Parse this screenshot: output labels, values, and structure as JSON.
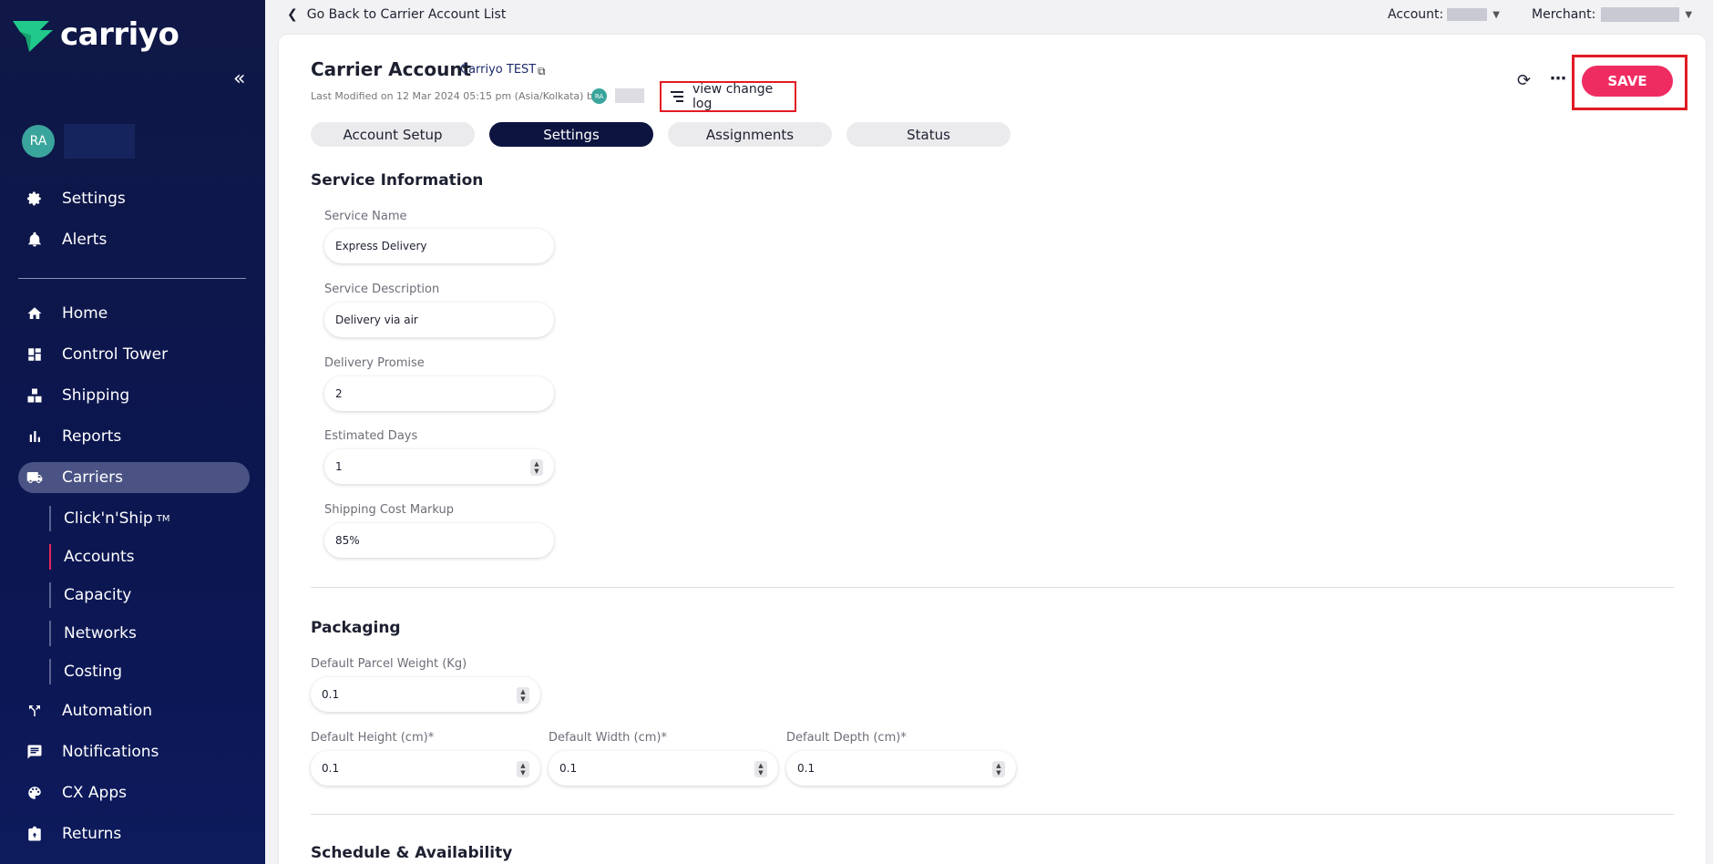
{
  "brand": {
    "name": "carriyo"
  },
  "sidebar": {
    "collapse_icon": "double-chevron-left-icon",
    "user_initials": "RA",
    "top_items": [
      {
        "label": "Settings",
        "icon": "gear-icon"
      },
      {
        "label": "Alerts",
        "icon": "bell-icon"
      }
    ],
    "items": [
      {
        "label": "Home",
        "icon": "home-icon"
      },
      {
        "label": "Control Tower",
        "icon": "dashboard-icon"
      },
      {
        "label": "Shipping",
        "icon": "boxes-icon"
      },
      {
        "label": "Reports",
        "icon": "bar-chart-icon"
      },
      {
        "label": "Carriers",
        "icon": "truck-icon"
      },
      {
        "label": "Automation",
        "icon": "fork-icon"
      },
      {
        "label": "Notifications",
        "icon": "message-icon"
      },
      {
        "label": "CX Apps",
        "icon": "palette-icon"
      },
      {
        "label": "Returns",
        "icon": "return-box-icon"
      }
    ],
    "carrier_sub_items": [
      {
        "label": "Click'n'Ship",
        "sup": "TM"
      },
      {
        "label": "Accounts"
      },
      {
        "label": "Capacity"
      },
      {
        "label": "Networks"
      },
      {
        "label": "Costing"
      }
    ]
  },
  "topbar": {
    "back_label": "Go Back to Carrier Account List",
    "account_label": "Account:",
    "merchant_label": "Merchant:"
  },
  "header": {
    "title": "Carrier Account",
    "account_name": "Carriyo TEST",
    "last_modified": "Last Modified on 12 Mar 2024 05:15 pm (Asia/Kolkata) by",
    "modifier_initials": "RA",
    "change_log_label": "view change log",
    "save_label": "SAVE"
  },
  "tabs": [
    {
      "label": "Account Setup",
      "active": false
    },
    {
      "label": "Settings",
      "active": true
    },
    {
      "label": "Assignments",
      "active": false
    },
    {
      "label": "Status",
      "active": false
    }
  ],
  "service_information": {
    "title": "Service Information",
    "service_name": {
      "label": "Service Name",
      "value": "Express Delivery"
    },
    "service_description": {
      "label": "Service Description",
      "value": "Delivery via air"
    },
    "delivery_promise": {
      "label": "Delivery Promise",
      "value": "2"
    },
    "estimated_days": {
      "label": "Estimated Days",
      "value": "1"
    },
    "shipping_cost_markup": {
      "label": "Shipping Cost Markup",
      "value": "85%"
    }
  },
  "packaging": {
    "title": "Packaging",
    "parcel_weight": {
      "label": "Default Parcel Weight (Kg)",
      "value": "0.1"
    },
    "height": {
      "label": "Default Height (cm)*",
      "value": "0.1"
    },
    "width": {
      "label": "Default Width (cm)*",
      "value": "0.1"
    },
    "depth": {
      "label": "Default Depth (cm)*",
      "value": "0.1"
    }
  },
  "schedule": {
    "title": "Schedule & Availability"
  },
  "colors": {
    "sidebar_bg": "#0f1846",
    "accent_pink": "#ef2c62",
    "active_tab": "#0d1440",
    "highlight_red": "#e21b23"
  }
}
